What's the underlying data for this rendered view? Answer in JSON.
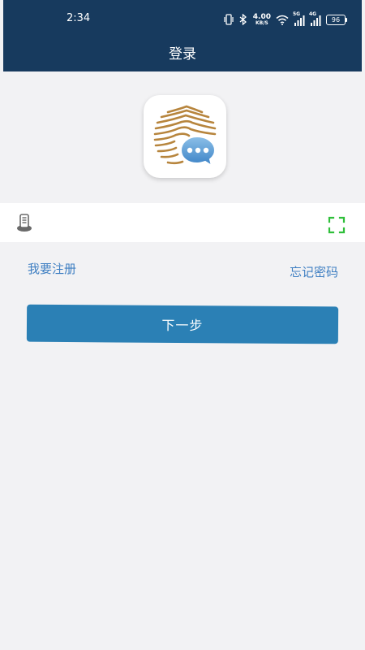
{
  "status_bar": {
    "time": "2:34",
    "net_speed": "4.00",
    "net_unit": "KB/S",
    "signal_1_tag": "5G",
    "signal_2_tag": "4G",
    "battery": "96"
  },
  "nav": {
    "title": "登录"
  },
  "login": {
    "account_value": "",
    "account_placeholder": ""
  },
  "links": {
    "register": "我要注册",
    "forgot_password": "忘记密码"
  },
  "actions": {
    "next": "下一步"
  },
  "colors": {
    "header_bg": "#173a5e",
    "accent_blue": "#2b80b5",
    "link_blue": "#3f7fc2",
    "scan_green": "#2fbf3a",
    "logo_gold": "#b7853d"
  },
  "icons": {
    "phone": "phone-icon",
    "scan": "scan-icon",
    "chat": "chat-bubble-icon"
  }
}
